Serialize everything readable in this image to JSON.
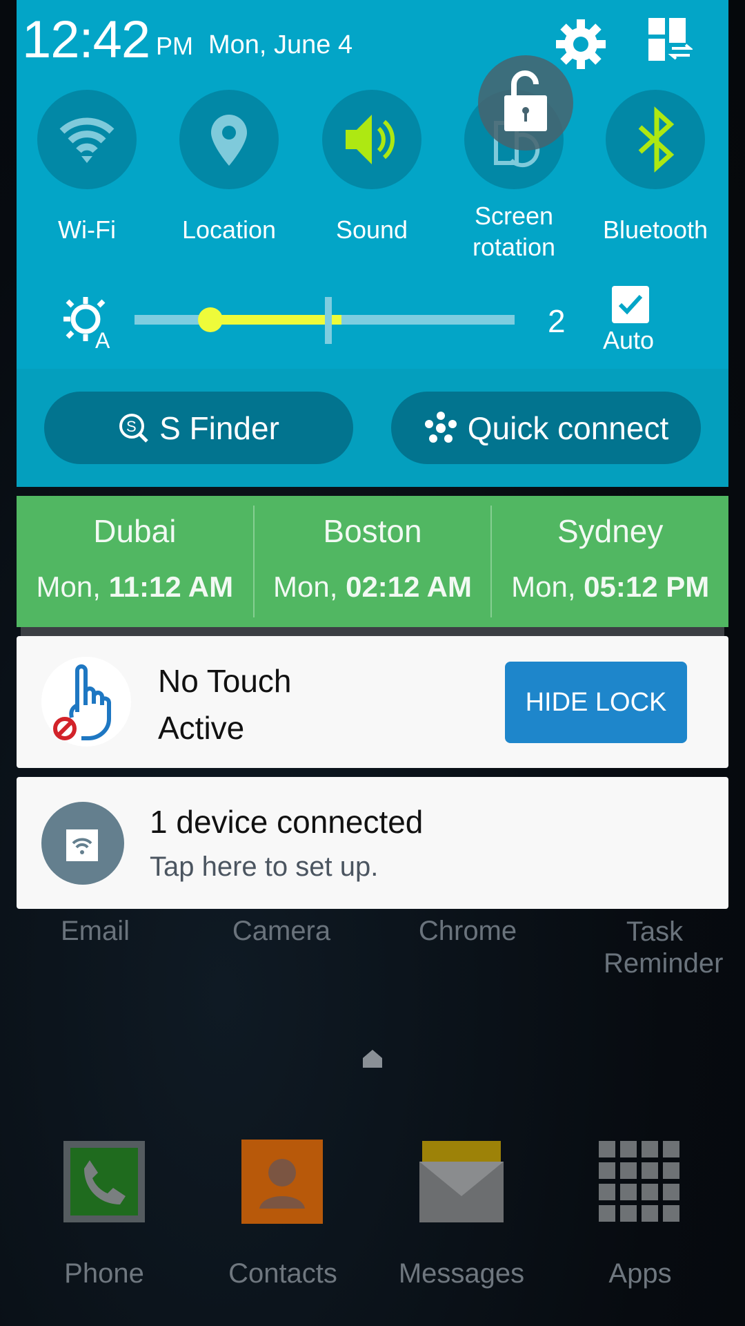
{
  "status": {
    "time": "12:42",
    "ampm": "PM",
    "date": "Mon, June 4"
  },
  "header_icons": [
    "gear-icon",
    "edit-tiles-icon"
  ],
  "tiles": [
    {
      "label": "Wi-Fi",
      "icon": "wifi-icon",
      "active": false
    },
    {
      "label": "Location",
      "icon": "location-pin-icon",
      "active": false
    },
    {
      "label": "Sound",
      "icon": "speaker-icon",
      "active": true
    },
    {
      "label": "Screen rotation",
      "icon": "screen-rotation-icon",
      "active": false
    },
    {
      "label": "Bluetooth",
      "icon": "bluetooth-icon",
      "active": true
    }
  ],
  "overlay_icon": "unlocked-padlock-icon",
  "brightness": {
    "value": "2",
    "auto_label": "Auto",
    "auto_checked": true,
    "level_percent": 20
  },
  "actions": {
    "sfinder": "S Finder",
    "quick_connect": "Quick connect"
  },
  "world_clock": [
    {
      "city": "Dubai",
      "day": "Mon, ",
      "time": "11:12 AM"
    },
    {
      "city": "Boston",
      "day": "Mon, ",
      "time": "02:12 AM"
    },
    {
      "city": "Sydney",
      "day": "Mon, ",
      "time": "05:12 PM"
    }
  ],
  "notifications": [
    {
      "title": "No Touch",
      "subtitle": "Active",
      "button": "HIDE LOCK"
    },
    {
      "title": "1 device connected",
      "subtitle": "Tap here to set up."
    }
  ],
  "home_apps": [
    "Email",
    "Camera",
    "Chrome",
    "Task Reminder"
  ],
  "dock": [
    "Phone",
    "Contacts",
    "Messages",
    "Apps"
  ],
  "colors": {
    "panel": "#03a5c7",
    "tile": "#0288a6",
    "accent": "#aee812",
    "clock": "#51b762",
    "button": "#1e86cb"
  }
}
